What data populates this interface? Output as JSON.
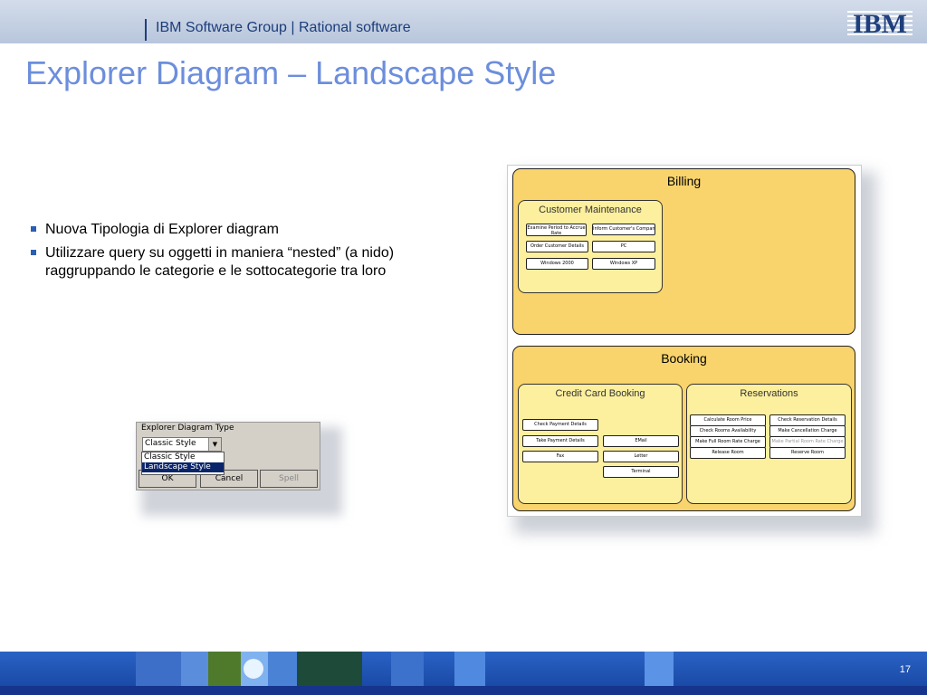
{
  "header": {
    "group": "IBM Software Group | Rational software",
    "logo": "IBM"
  },
  "title": "Explorer Diagram – Landscape Style",
  "bullets": [
    "Nuova Tipologia di Explorer diagram",
    "Utilizzare query su oggetti in maniera “nested” (a nido) raggruppando le categorie e le sottocategorie tra loro"
  ],
  "dialog": {
    "legend": "Explorer Diagram Type",
    "selected": "Classic Style",
    "options": [
      "Classic Style",
      "Landscape Style"
    ],
    "buttons": {
      "ok": "OK",
      "cancel": "Cancel",
      "spell": "Spell"
    }
  },
  "diagram": {
    "billing": {
      "title": "Billing",
      "customer_maintenance": {
        "title": "Customer Maintenance",
        "items": [
          "Examine Period to Accrue Rate",
          "Inform Customer's Company",
          "Order Customer Details",
          "PC",
          "Windows 2000",
          "Windows XP"
        ]
      }
    },
    "booking": {
      "title": "Booking",
      "credit_card_booking": {
        "title": "Credit Card Booking",
        "items": [
          "Check Payment Details",
          "Take Payment Details",
          "EMail",
          "Fax",
          "Letter",
          "Terminal"
        ]
      },
      "reservations": {
        "title": "Reservations",
        "items": [
          "Calculate Room Price",
          "Check Reservation Details",
          "Check Rooms Availability",
          "Make Cancellation Charge",
          "Make Full Room Rate Charge",
          "Make Partial Room Rate Charge",
          "Release Room",
          "Reserve Room"
        ]
      }
    }
  },
  "footer": {
    "page_number": "17"
  },
  "colors": {
    "title": "#6c8edc",
    "panel": "#f9d46c",
    "subpanel": "#fcef9e",
    "footer": "#1f55b8"
  }
}
